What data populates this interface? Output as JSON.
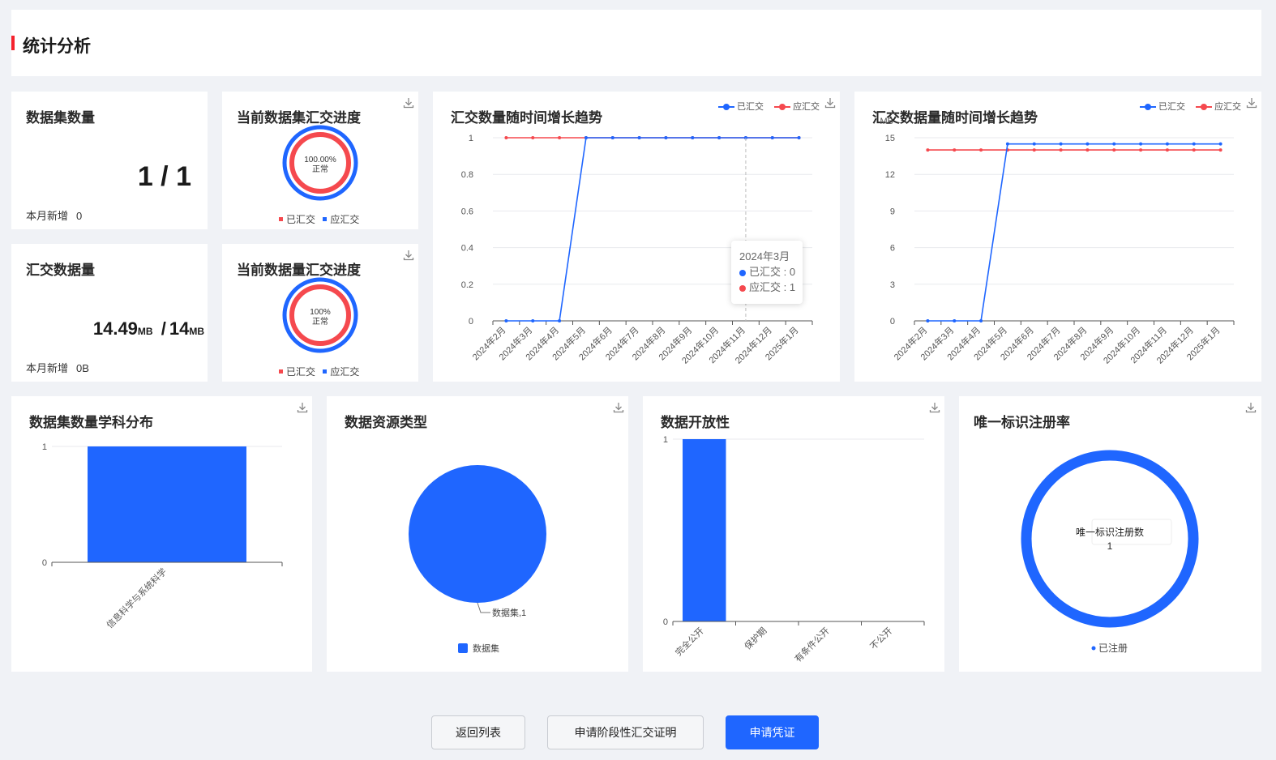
{
  "header": {
    "title": "统计分析"
  },
  "dataset_count_card": {
    "title": "数据集数量",
    "value": "1 / 1",
    "monthly_label": "本月新增",
    "monthly_value": "0"
  },
  "volume_card": {
    "title": "汇交数据量",
    "value_main": "14.49",
    "value_unit": "MB",
    "separator": "/",
    "value_total": "14",
    "total_unit": "MB",
    "monthly_label": "本月新增",
    "monthly_value": "0B"
  },
  "dataset_progress": {
    "title": "当前数据集汇交进度",
    "percent": "100.00%",
    "status": "正常",
    "legend_submitted": "已汇交",
    "legend_required": "应汇交"
  },
  "volume_progress": {
    "title": "当前数据量汇交进度",
    "percent": "100%",
    "status": "正常",
    "legend_submitted": "已汇交",
    "legend_required": "应汇交"
  },
  "colors": {
    "blue": "#1f66ff",
    "red": "#f5494e",
    "accent_bar": "#f5222d"
  },
  "tooltip": {
    "title": "2024年3月",
    "submitted": "已汇交 : 0",
    "required": "应汇交 : 1"
  },
  "footer": {
    "back_label": "返回列表",
    "stage_cert_label": "申请阶段性汇交证明",
    "apply_label": "申请凭证"
  },
  "chart_data": [
    {
      "id": "count_trend",
      "type": "line",
      "title": "汇交数量随时间增长趋势",
      "categories": [
        "2024年2月",
        "2024年3月",
        "2024年4月",
        "2024年5月",
        "2024年6月",
        "2024年7月",
        "2024年8月",
        "2024年9月",
        "2024年10月",
        "2024年11月",
        "2024年12月",
        "2025年1月"
      ],
      "series": [
        {
          "name": "已汇交",
          "color": "#1f66ff",
          "values": [
            0,
            0,
            0,
            1,
            1,
            1,
            1,
            1,
            1,
            1,
            1,
            1
          ]
        },
        {
          "name": "应汇交",
          "color": "#f5494e",
          "values": [
            1,
            1,
            1,
            1,
            1,
            1,
            1,
            1,
            1,
            1,
            1,
            1
          ]
        }
      ],
      "yticks": [
        "0",
        "0.2",
        "0.4",
        "0.6",
        "0.8",
        "1"
      ],
      "ylim": [
        0,
        1
      ],
      "ylabel": "",
      "grid": true,
      "legend": "top-right"
    },
    {
      "id": "volume_trend",
      "type": "line",
      "title": "汇交数据量随时间增长趋势",
      "categories": [
        "2024年2月",
        "2024年3月",
        "2024年4月",
        "2024年5月",
        "2024年6月",
        "2024年7月",
        "2024年8月",
        "2024年9月",
        "2024年10月",
        "2024年11月",
        "2024年12月",
        "2025年1月"
      ],
      "series": [
        {
          "name": "已汇交",
          "color": "#1f66ff",
          "values": [
            0,
            0,
            0,
            14.49,
            14.49,
            14.49,
            14.49,
            14.49,
            14.49,
            14.49,
            14.49,
            14.49
          ]
        },
        {
          "name": "应汇交",
          "color": "#f5494e",
          "values": [
            14,
            14,
            14,
            14,
            14,
            14,
            14,
            14,
            14,
            14,
            14,
            14
          ]
        }
      ],
      "yticks": [
        "0",
        "3",
        "6",
        "9",
        "12",
        "15"
      ],
      "ylim": [
        0,
        15
      ],
      "ylabel": "MB",
      "grid": true,
      "legend": "top-right"
    },
    {
      "id": "discipline_bar",
      "type": "bar",
      "title": "数据集数量学科分布",
      "categories": [
        "信息科学与系统科学"
      ],
      "values": [
        1
      ],
      "yticks": [
        "0",
        "1"
      ],
      "ylim": [
        0,
        1
      ],
      "color": "#1f66ff"
    },
    {
      "id": "resource_type_pie",
      "type": "pie",
      "title": "数据资源类型",
      "slices": [
        {
          "label": "数据集",
          "value": 1,
          "color": "#1f66ff"
        }
      ],
      "slice_label": "数据集,1",
      "legend": "bottom"
    },
    {
      "id": "openness_bar",
      "type": "bar",
      "title": "数据开放性",
      "categories": [
        "完全公开",
        "保护期",
        "有条件公开",
        "不公开"
      ],
      "values": [
        1,
        0,
        0,
        0
      ],
      "yticks": [
        "0",
        "1"
      ],
      "ylim": [
        0,
        1
      ],
      "color": "#1f66ff"
    },
    {
      "id": "unique_id_donut",
      "type": "pie",
      "title": "唯一标识注册率",
      "slices": [
        {
          "label": "已注册",
          "value": 1,
          "color": "#1f66ff"
        }
      ],
      "center_label": "唯一标识注册数",
      "center_value": "1",
      "legend": "bottom"
    }
  ]
}
